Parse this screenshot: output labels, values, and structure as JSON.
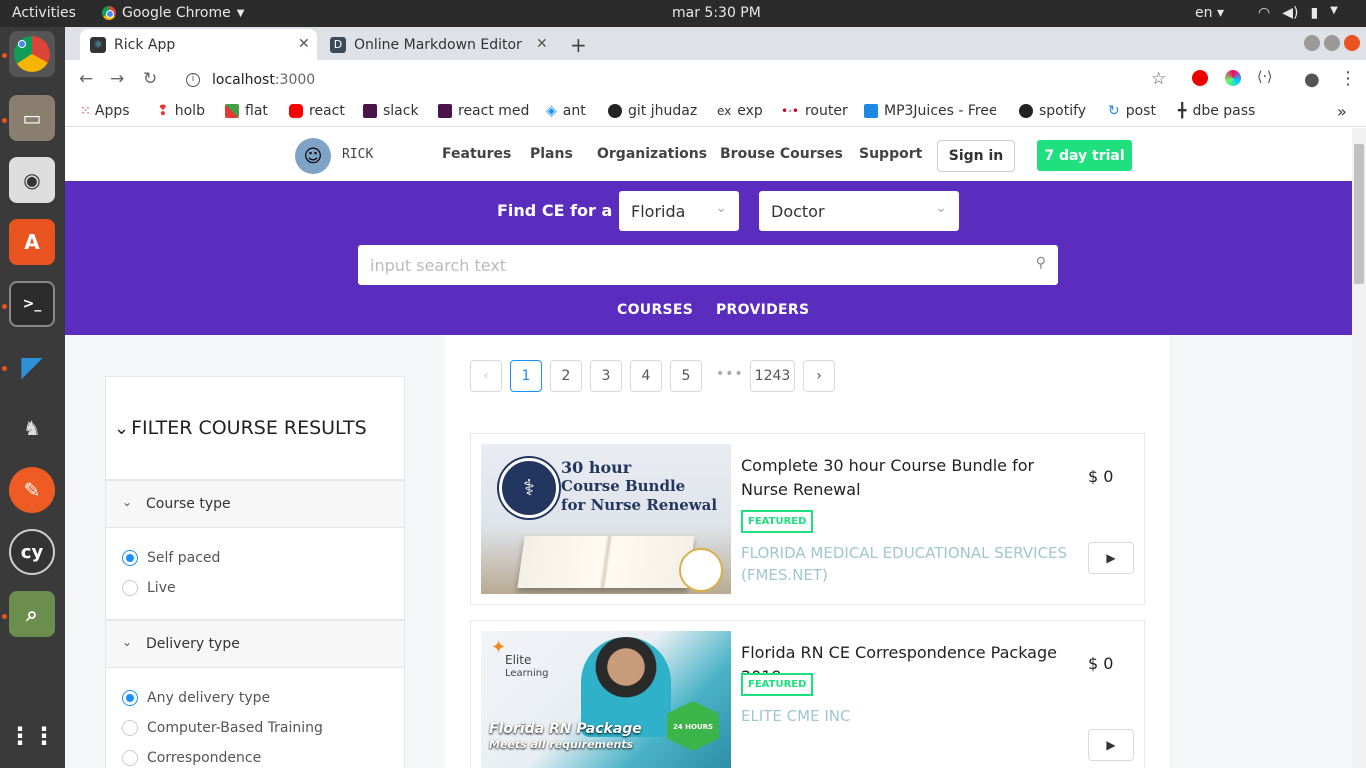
{
  "system": {
    "activities": "Activities",
    "app_name": "Google Chrome",
    "clock": "mar  5:30 PM",
    "lang": "en"
  },
  "browser": {
    "tabs": [
      {
        "label": "Rick App"
      },
      {
        "label": "Online Markdown Editor"
      }
    ],
    "url_host": "localhost",
    "url_port": ":3000",
    "bookmarks": [
      {
        "label": "Apps",
        "color": "#e0443f"
      },
      {
        "label": "holb",
        "color": "#e53935"
      },
      {
        "label": "flat",
        "color": "#43a047"
      },
      {
        "label": "react",
        "color": "#ff0000"
      },
      {
        "label": "slack",
        "color": "#4a154b"
      },
      {
        "label": "react med",
        "color": "#4a154b"
      },
      {
        "label": "ant",
        "color": "#1890ff"
      },
      {
        "label": "git jhudaz",
        "color": "#222222"
      },
      {
        "label": "exp",
        "color": "#555555"
      },
      {
        "label": "router",
        "color": "#d0021b"
      },
      {
        "label": "MP3Juices - Free",
        "color": "#1e88e5"
      },
      {
        "label": "spotify",
        "color": "#222222"
      },
      {
        "label": "post",
        "color": "#1e88e5"
      },
      {
        "label": "dbe pass",
        "color": "#333333"
      }
    ]
  },
  "site": {
    "brand": "RICK",
    "menu": [
      "Features",
      "Plans",
      "Organizations",
      "Brouse Courses",
      "Support"
    ],
    "signin": "Sign in",
    "trial": "7 day trial",
    "find_label": "Find CE for a",
    "state_select": "Florida",
    "profession_select": "Doctor",
    "search_placeholder": "input search text",
    "banner_tabs": [
      "COURSES",
      "PROVIDERS"
    ],
    "accent": "#5b2dbf",
    "trial_color": "#1ee07f"
  },
  "filter": {
    "title": "FILTER COURSE RESULTS",
    "course_type": {
      "label": "Course type",
      "options": [
        "Self paced",
        "Live"
      ],
      "selected": "Self paced"
    },
    "delivery_type": {
      "label": "Delivery type",
      "options": [
        "Any delivery type",
        "Computer-Based Training",
        "Correspondence"
      ],
      "selected": "Any delivery type"
    }
  },
  "pagination": {
    "prev": "‹",
    "pages": [
      "1",
      "2",
      "3",
      "4",
      "5"
    ],
    "current": "1",
    "ellipsis": "•••",
    "last": "1243",
    "next": "›"
  },
  "courses": [
    {
      "title": "Complete 30 hour Course Bundle for Nurse Renewal",
      "price": "$ 0",
      "badge": "FEATURED",
      "provider": "FLORIDA MEDICAL EDUCATIONAL SERVICES (FMES.NET)",
      "image_text": [
        "30 hour",
        "Course Bundle",
        "for Nurse Renewal"
      ]
    },
    {
      "title": "Florida RN CE Correspondence Package 2019",
      "price": "$ 0",
      "badge": "FEATURED",
      "provider": "ELITE CME INC",
      "image_text": [
        "Elite",
        "Learning",
        "Florida RN Package",
        "Meets all requirements",
        "24 HOURS"
      ]
    }
  ]
}
